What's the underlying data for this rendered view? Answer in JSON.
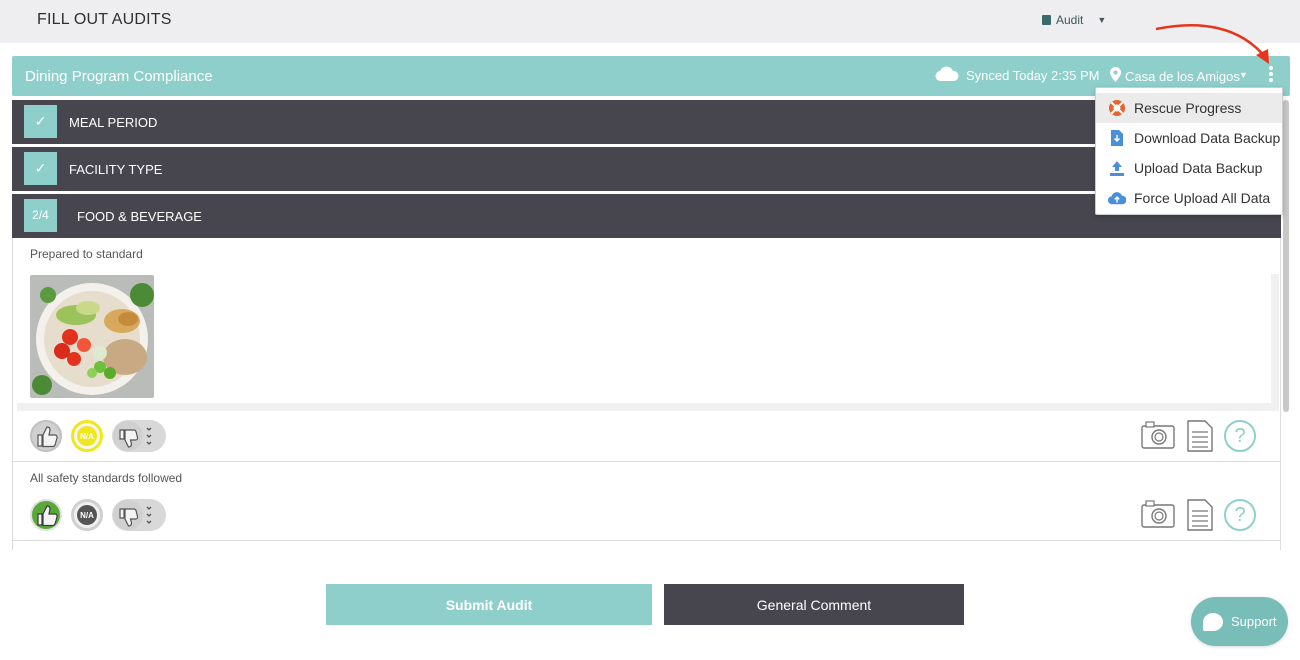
{
  "page": {
    "title": "FILL OUT AUDITS"
  },
  "audit_menu": {
    "label": "Audit",
    "caret": "▼",
    "icon": "document-icon"
  },
  "form": {
    "title": "Dining Program Compliance",
    "sync_status": "Synced Today 2:35 PM",
    "location": "Casa de los Amigos",
    "location_caret": "▼"
  },
  "sections": [
    {
      "badge": "✓",
      "label": "MEAL PERIOD"
    },
    {
      "badge": "✓",
      "label": "FACILITY TYPE"
    },
    {
      "badge": "2/4",
      "label": "FOOD & BEVERAGE"
    }
  ],
  "questions": [
    {
      "label": "Prepared to standard",
      "na_label": "N/A",
      "selected": "na"
    },
    {
      "label": "All safety standards followed",
      "na_label": "N/A",
      "selected": "yes"
    }
  ],
  "tools": {
    "help_glyph": "?"
  },
  "buttons": {
    "submit": "Submit Audit",
    "comment": "General Comment",
    "support": "Support"
  },
  "dropdown": {
    "items": [
      {
        "label": "Rescue Progress",
        "icon": "lifebuoy-icon",
        "color": "#e8622c"
      },
      {
        "label": "Download Data Backup",
        "icon": "file-download-icon",
        "color": "#4a90d9"
      },
      {
        "label": "Upload Data Backup",
        "icon": "upload-icon",
        "color": "#4a90d9"
      },
      {
        "label": "Force Upload All Data",
        "icon": "cloud-upload-icon",
        "color": "#4a90d9"
      }
    ]
  },
  "colors": {
    "accent": "#8fcfcb",
    "dark": "#47464f",
    "annotation_arrow": "#e8341c",
    "na_selected": "#f0e81c",
    "yes_selected": "#5aa83a"
  }
}
